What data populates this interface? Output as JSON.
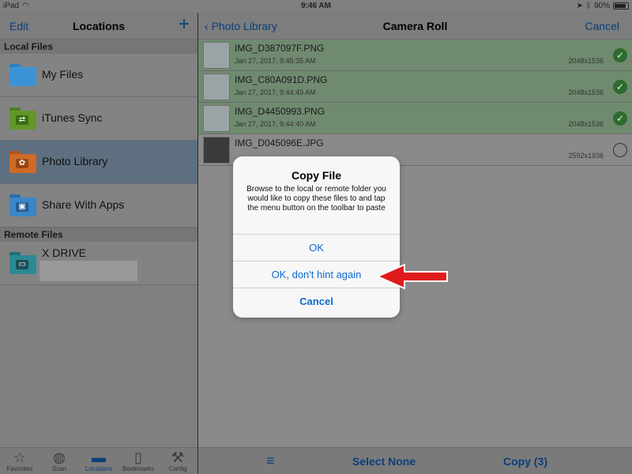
{
  "status": {
    "device": "iPad",
    "time": "9:46 AM",
    "battery": "90%"
  },
  "left": {
    "nav": {
      "edit": "Edit",
      "title": "Locations",
      "add": "+"
    },
    "local_header": "Local Files",
    "local_items": [
      {
        "label": "My Files"
      },
      {
        "label": "iTunes Sync"
      },
      {
        "label": "Photo Library"
      },
      {
        "label": "Share With Apps"
      }
    ],
    "remote_header": "Remote Files",
    "remote_items": [
      {
        "label": "X DRIVE"
      }
    ],
    "tabs": [
      {
        "label": "Favorites",
        "icon": "star-icon"
      },
      {
        "label": "Scan",
        "icon": "scan-icon"
      },
      {
        "label": "Locations",
        "icon": "folder-icon"
      },
      {
        "label": "Bookmarks",
        "icon": "book-icon"
      },
      {
        "label": "Config",
        "icon": "wrench-icon"
      }
    ]
  },
  "right": {
    "nav": {
      "back": "Photo Library",
      "title": "Camera Roll",
      "cancel": "Cancel"
    },
    "files": [
      {
        "name": "IMG_D387097F.PNG",
        "date": "Jan 27, 2017, 9:45:35 AM",
        "dims": "2048x1536",
        "selected": true
      },
      {
        "name": "IMG_C80A091D.PNG",
        "date": "Jan 27, 2017, 9:44:49 AM",
        "dims": "2048x1536",
        "selected": true
      },
      {
        "name": "IMG_D4450993.PNG",
        "date": "Jan 27, 2017, 9:44:40 AM",
        "dims": "2048x1536",
        "selected": true
      },
      {
        "name": "IMG_D045096E.JPG",
        "date": "",
        "dims": "2592x1936",
        "selected": false
      }
    ],
    "toolbar": {
      "menu": "≡",
      "select_none": "Select None",
      "copy": "Copy (3)"
    }
  },
  "dialog": {
    "title": "Copy File",
    "message": "Browse to the local or remote folder you would like to copy these files to and tap the menu button on the toolbar to paste",
    "buttons": {
      "ok": "OK",
      "ok_no_hint": "OK, don't hint again",
      "cancel": "Cancel"
    }
  },
  "colors": {
    "accent": "#0a6bd3",
    "arrow": "#e01b1b"
  }
}
